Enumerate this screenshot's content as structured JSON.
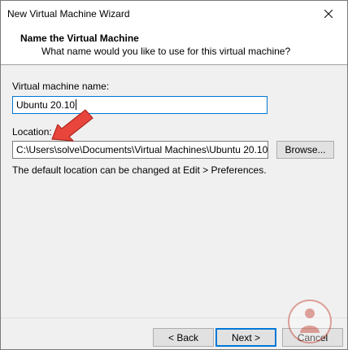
{
  "window": {
    "title": "New Virtual Machine Wizard"
  },
  "header": {
    "title": "Name the Virtual Machine",
    "subtitle": "What name would you like to use for this virtual machine?"
  },
  "form": {
    "vm_name_label": "Virtual machine name:",
    "vm_name_value": "Ubuntu 20.10",
    "location_label": "Location:",
    "location_value": "C:\\Users\\solve\\Documents\\Virtual Machines\\Ubuntu 20.10",
    "browse_label": "Browse...",
    "hint": "The default location can be changed at Edit > Preferences."
  },
  "footer": {
    "back_label": "< Back",
    "next_label": "Next >",
    "cancel_label": "Cancel"
  },
  "colors": {
    "accent": "#0078d7",
    "annotation_arrow": "#e8453c",
    "watermark": "#c0392b"
  },
  "icons": [
    "close-icon",
    "annotation-arrow-icon",
    "watermark-logo-icon"
  ]
}
